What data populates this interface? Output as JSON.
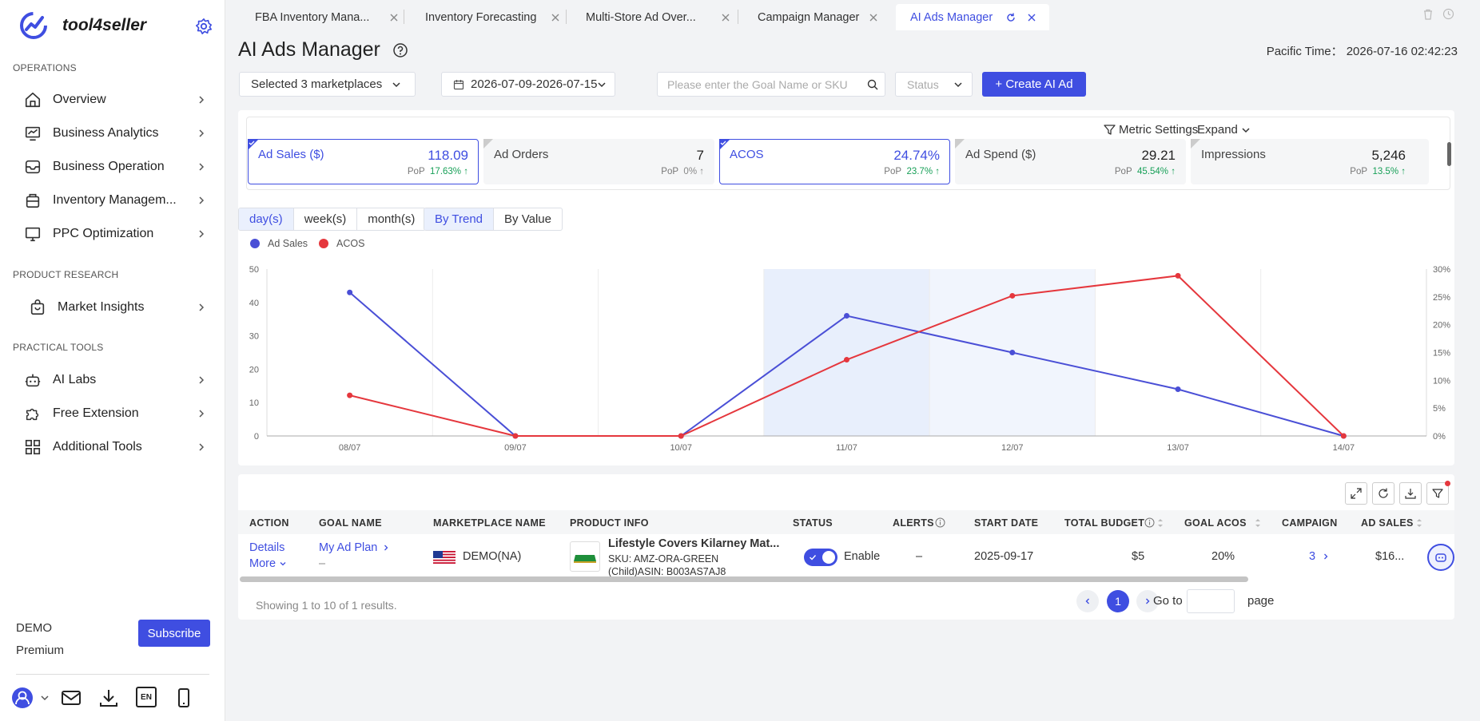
{
  "app": {
    "brand": "tool4seller",
    "page_title": "AI Ads Manager",
    "pacific_time": "Pacific Time： 2026-07-16 02:42:23"
  },
  "sidebar": {
    "sections": [
      {
        "title": "OPERATIONS",
        "items": [
          {
            "label": "Overview",
            "icon": "home-icon"
          },
          {
            "label": "Business Analytics",
            "icon": "analytics-icon"
          },
          {
            "label": "Business Operation",
            "icon": "inbox-icon"
          },
          {
            "label": "Inventory Managem...",
            "icon": "inventory-icon"
          },
          {
            "label": "PPC Optimization",
            "icon": "monitor-icon"
          }
        ]
      },
      {
        "title": "PRODUCT RESEARCH",
        "items": [
          {
            "label": "Market Insights",
            "icon": "shopping-bag-icon"
          }
        ]
      },
      {
        "title": "PRACTICAL TOOLS",
        "items": [
          {
            "label": "AI Labs",
            "icon": "robot-icon"
          },
          {
            "label": "Free Extension",
            "icon": "puzzle-icon"
          },
          {
            "label": "Additional Tools",
            "icon": "grid-icon"
          }
        ]
      }
    ],
    "footer": {
      "account": "DEMO",
      "plan": "Premium",
      "subscribe": "Subscribe",
      "lang": "EN"
    }
  },
  "tabs": [
    {
      "label": "FBA Inventory Mana...",
      "active": false
    },
    {
      "label": "Inventory Forecasting",
      "active": false
    },
    {
      "label": "Multi-Store Ad Over...",
      "active": false
    },
    {
      "label": "Campaign Manager",
      "active": false
    },
    {
      "label": "AI Ads Manager",
      "active": true
    }
  ],
  "filters": {
    "marketplaces": "Selected 3 marketplaces",
    "date_range": "2026-07-09-2026-07-15",
    "search_placeholder": "Please enter the Goal Name or SKU",
    "status_placeholder": "Status",
    "create_button": "+ Create AI Ad"
  },
  "metrics_header": {
    "settings": "Metric Settings",
    "expand": "Expand"
  },
  "kpis": [
    {
      "name": "Ad Sales ($)",
      "value": "118.09",
      "pop_label": "PoP",
      "pop": "17.63%",
      "arrow": "↑",
      "selected": true
    },
    {
      "name": "Ad Orders",
      "value": "7",
      "pop_label": "PoP",
      "pop": "0%",
      "arrow": "↑",
      "selected": false
    },
    {
      "name": "ACOS",
      "value": "24.74%",
      "pop_label": "PoP",
      "pop": "23.7%",
      "arrow": "↑",
      "selected": true
    },
    {
      "name": "Ad Spend ($)",
      "value": "29.21",
      "pop_label": "PoP",
      "pop": "45.54%",
      "arrow": "↑",
      "selected": false
    },
    {
      "name": "Impressions",
      "value": "5,246",
      "pop_label": "PoP",
      "pop": "13.5%",
      "arrow": "↑",
      "selected": false
    }
  ],
  "granularity": [
    "day(s)",
    "week(s)",
    "month(s)"
  ],
  "view_mode": [
    "By Trend",
    "By Value"
  ],
  "chart_data": {
    "type": "line",
    "x": [
      "08/07",
      "09/07",
      "10/07",
      "11/07",
      "12/07",
      "13/07",
      "14/07"
    ],
    "series": [
      {
        "name": "Ad Sales",
        "axis": "left",
        "color": "#4a4fd6",
        "values": [
          43,
          0,
          0,
          36,
          25,
          14,
          0
        ]
      },
      {
        "name": "ACOS",
        "axis": "right",
        "color": "#e5373d",
        "values": [
          7.3,
          0,
          0,
          13.7,
          25.2,
          28.8,
          0
        ]
      }
    ],
    "y_left": {
      "ticks": [
        "0",
        "10",
        "20",
        "30",
        "40",
        "50"
      ],
      "range": [
        0,
        50
      ]
    },
    "y_right": {
      "ticks": [
        "0%",
        "5%",
        "10%",
        "15%",
        "20%",
        "25%",
        "30%"
      ],
      "range": [
        0,
        30
      ]
    },
    "highlighted_categories": [
      "11/07",
      "12/07"
    ],
    "grid": true,
    "legend": "top-left"
  },
  "table": {
    "headers": [
      "ACTION",
      "GOAL NAME",
      "MARKETPLACE NAME",
      "PRODUCT INFO",
      "STATUS",
      "ALERTS",
      "START DATE",
      "TOTAL BUDGET",
      "GOAL ACOS",
      "CAMPAIGN",
      "AD SALES"
    ],
    "rows": [
      {
        "action_details": "Details",
        "action_more": "More",
        "goal_name": "My Ad Plan",
        "goal_sub": "–",
        "marketplace": "DEMO(NA)",
        "product_title": "Lifestyle Covers Kilarney Mat...",
        "product_sku": "SKU: AMZ-ORA-GREEN",
        "product_asin": "(Child)ASIN: B003AS7AJ8",
        "status": "Enable",
        "alerts": "–",
        "start_date": "2025-09-17",
        "total_budget": "$5",
        "goal_acos": "20%",
        "campaign": "3",
        "ad_sales": "$16..."
      }
    ],
    "showing": "Showing 1 to 10 of 1 results.",
    "current_page": "1",
    "goto_label": "Go to",
    "page_label": "page"
  },
  "colors": {
    "accent": "#3f4ee1",
    "sales": "#4a4fd6",
    "acos": "#e5373d",
    "positive": "#18a058"
  }
}
